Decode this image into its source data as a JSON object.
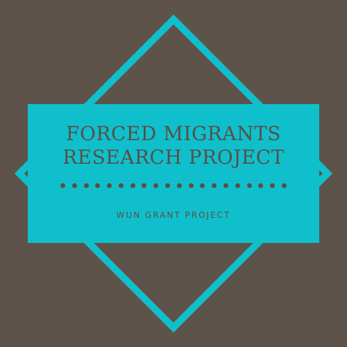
{
  "logo": {
    "title_line1": "FORCED MIGRANTS",
    "title_line2": "RESEARCH PROJECT",
    "subtitle": "WUN GRANT PROJECT"
  },
  "colors": {
    "background": "#5e534a",
    "accent": "#0fc0cc",
    "text": "#5a4f47"
  },
  "divider": {
    "dot_count": 20
  }
}
